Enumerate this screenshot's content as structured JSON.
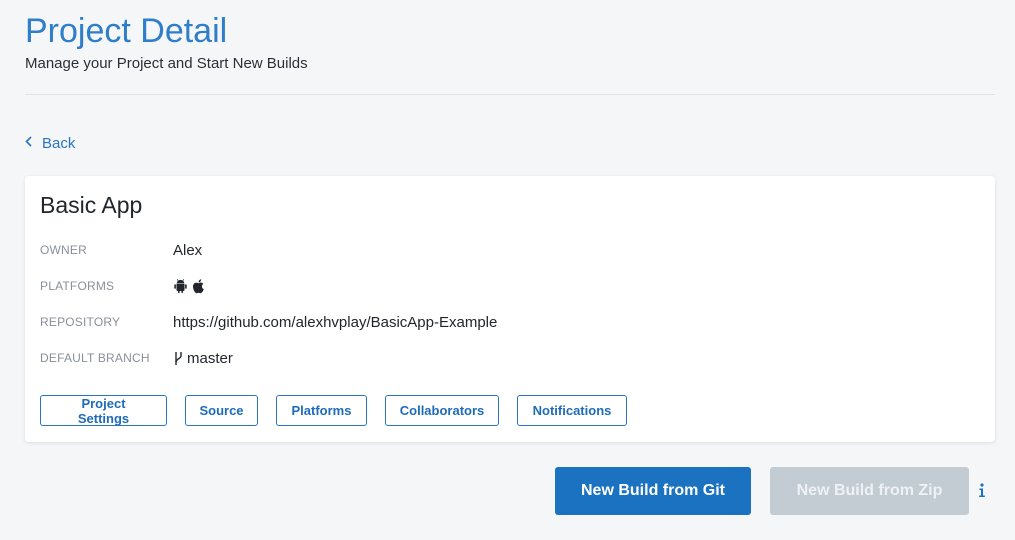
{
  "header": {
    "title": "Project Detail",
    "subtitle": "Manage your Project and Start New Builds"
  },
  "nav": {
    "back_label": "Back"
  },
  "project": {
    "name": "Basic App",
    "details": {
      "owner_label": "OWNER",
      "owner_value": "Alex",
      "platforms_label": "PLATFORMS",
      "platforms": [
        "android-icon",
        "apple-icon"
      ],
      "repository_label": "REPOSITORY",
      "repository_value": "https://github.com/alexhvplay/BasicApp-Example",
      "branch_label": "DEFAULT BRANCH",
      "branch_value": "master"
    },
    "actions": [
      "Project Settings",
      "Source",
      "Platforms",
      "Collaborators",
      "Notifications"
    ]
  },
  "builds": {
    "git_label": "New Build from Git",
    "zip_label": "New Build from Zip",
    "zip_disabled": true
  },
  "colors": {
    "accent": "#2f7ec9",
    "primary_button": "#1b72c1",
    "disabled_button": "#c3ccd3",
    "background": "#f5f6f8"
  }
}
